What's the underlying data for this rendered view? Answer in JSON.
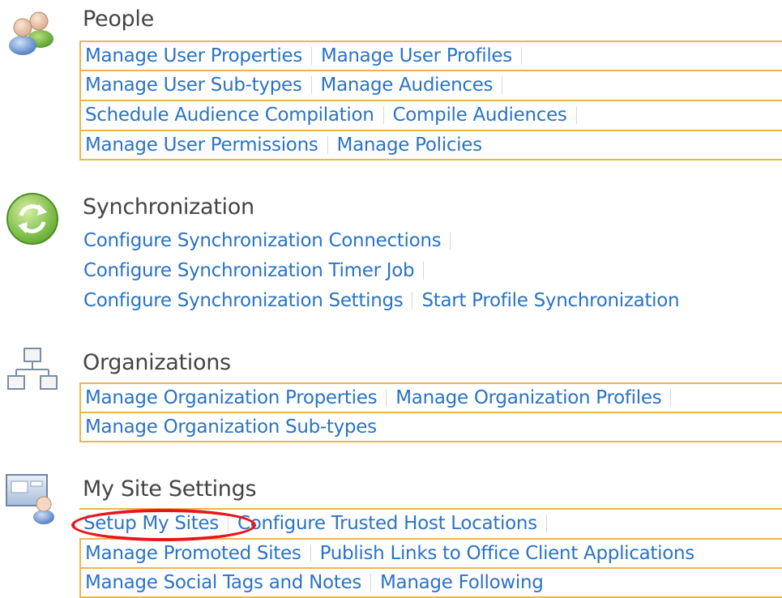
{
  "sections": [
    {
      "title": "People",
      "icon": "people-icon",
      "rows": [
        [
          "Manage User Properties",
          "Manage User Profiles"
        ],
        [
          "Manage User Sub-types",
          "Manage Audiences"
        ],
        [
          "Schedule Audience Compilation",
          "Compile Audiences"
        ],
        [
          "Manage User Permissions",
          "Manage Policies"
        ]
      ]
    },
    {
      "title": "Synchronization",
      "icon": "sync-icon",
      "rows": [
        [
          "Configure Synchronization Connections"
        ],
        [
          "Configure Synchronization Timer Job"
        ],
        [
          "Configure Synchronization Settings",
          "Start Profile Synchronization"
        ]
      ]
    },
    {
      "title": "Organizations",
      "icon": "org-chart-icon",
      "rows": [
        [
          "Manage Organization Properties",
          "Manage Organization Profiles"
        ],
        [
          "Manage Organization Sub-types"
        ]
      ]
    },
    {
      "title": "My Site Settings",
      "icon": "my-site-icon",
      "rows": [
        [
          "Setup My Sites",
          "Configure Trusted Host Locations"
        ],
        [
          "Manage Promoted Sites",
          "Publish Links to Office Client Applications"
        ],
        [
          "Manage Social Tags and Notes",
          "Manage Following"
        ]
      ]
    }
  ],
  "colors": {
    "link": "#2a73c6",
    "highlight_box": "#f0b44c",
    "annotation_circle": "#e8151c",
    "title": "#444444"
  }
}
